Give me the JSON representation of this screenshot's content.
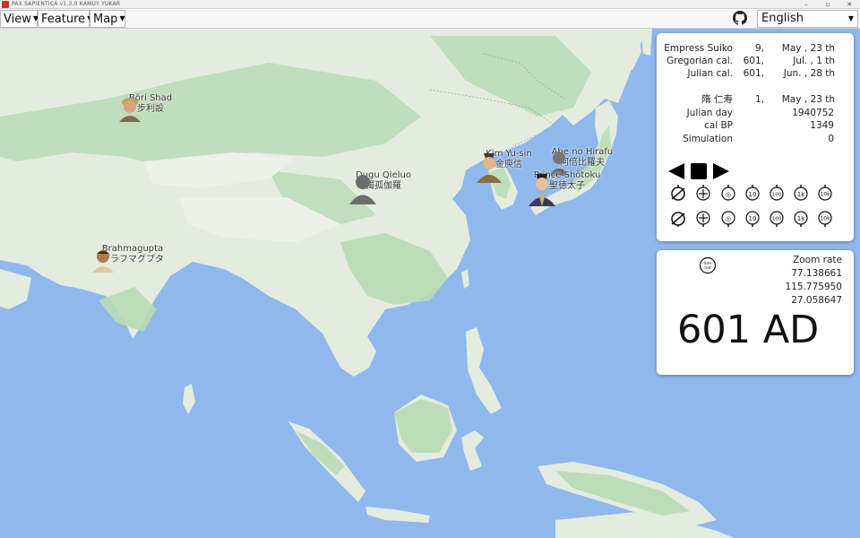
{
  "window": {
    "title": "PAX SAPIENTICA v1.3.0 KAMUY YUKAR",
    "minimize": "–",
    "maximize": "▫",
    "close": "✕"
  },
  "menu": {
    "view": "View",
    "feature": "Feature",
    "map": "Map",
    "language": "English"
  },
  "persons": [
    {
      "name": "Böri Shad",
      "name_native": "步利設"
    },
    {
      "name": "Brahmagupta",
      "name_native": "ブラフマグプタ"
    },
    {
      "name": "Dugu Qieluo",
      "name_native": "獨孤伽羅"
    },
    {
      "name": "Kim Yu-sin",
      "name_native": "金庾信"
    },
    {
      "name": "Abe no Hirafu",
      "name_native": "阿倍比羅夫"
    },
    {
      "name": "Prince Shōtoku",
      "name_native": "聖徳太子"
    }
  ],
  "calendar": {
    "suiko": {
      "label": "Empress Suiko",
      "year": "9,",
      "date": "May , 23 th"
    },
    "gregorian": {
      "label": "Gregorian cal.",
      "year": "601,",
      "date": "Jul. ,   1 th"
    },
    "julian": {
      "label": "Julian cal.",
      "year": "601,",
      "date": "Jun. , 28 th"
    },
    "sui": {
      "label": "隋 仁寿",
      "year": "1,",
      "date": "May , 23 th"
    },
    "julian_day": {
      "label": "Julian day",
      "value": "1940752"
    },
    "cal_bp": {
      "label": "cal BP",
      "value": "1349"
    },
    "simulation": {
      "label": "Simulation",
      "value": "0"
    }
  },
  "controls": {
    "speeds": [
      "1",
      "10",
      "100",
      "1k",
      "10k"
    ]
  },
  "zoom": {
    "label": "Zoom rate",
    "rate": "77.138661",
    "longitude": "115.775950",
    "latitude": "27.058647",
    "sim_icon_text": "Sim init",
    "year_display": "601 AD"
  },
  "colors": {
    "sea": "#8fb8ec",
    "land": "#e4ece0",
    "forest": "#b8dcb4"
  }
}
